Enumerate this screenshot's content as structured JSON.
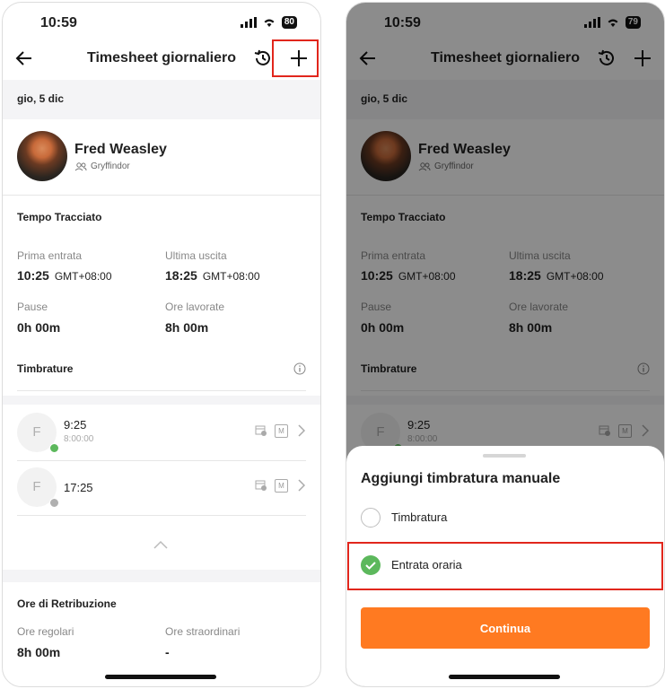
{
  "left": {
    "time": "10:59",
    "battery": "80",
    "title": "Timesheet giornaliero",
    "date": "gio, 5 dic",
    "user": {
      "name": "Fred Weasley",
      "team": "Gryffindor"
    },
    "tracked": {
      "title": "Tempo Tracciato",
      "first_in_label": "Prima entrata",
      "first_in_time": "10:25",
      "first_in_tz": "GMT+08:00",
      "last_out_label": "Ultima uscita",
      "last_out_time": "18:25",
      "last_out_tz": "GMT+08:00",
      "pause_label": "Pause",
      "pause_value": "0h 00m",
      "worked_label": "Ore lavorate",
      "worked_value": "8h 00m"
    },
    "punches": {
      "title": "Timbrature",
      "items": [
        {
          "initial": "F",
          "time": "9:25",
          "sub": "8:00:00",
          "badge": "M",
          "status_color": "#5cb85c"
        },
        {
          "initial": "F",
          "time": "17:25",
          "sub": "",
          "badge": "M",
          "status_color": "#b0b0b0"
        }
      ]
    },
    "pay": {
      "title": "Ore di Retribuzione",
      "regular_label": "Ore regolari",
      "regular_value": "8h 00m",
      "overtime_label": "Ore straordinari",
      "overtime_value": "-"
    }
  },
  "right": {
    "time": "10:59",
    "battery": "79",
    "title": "Timesheet giornaliero",
    "date": "gio, 5 dic",
    "user": {
      "name": "Fred Weasley",
      "team": "Gryffindor"
    },
    "tracked": {
      "title": "Tempo Tracciato",
      "first_in_label": "Prima entrata",
      "first_in_time": "10:25",
      "first_in_tz": "GMT+08:00",
      "last_out_label": "Ultima uscita",
      "last_out_time": "18:25",
      "last_out_tz": "GMT+08:00",
      "pause_label": "Pause",
      "pause_value": "0h 00m",
      "worked_label": "Ore lavorate",
      "worked_value": "8h 00m"
    },
    "punches": {
      "title": "Timbrature",
      "items": [
        {
          "initial": "F",
          "time": "9:25",
          "sub": "8:00:00",
          "badge": "M"
        }
      ]
    },
    "sheet": {
      "title": "Aggiungi timbratura manuale",
      "option_1": "Timbratura",
      "option_2": "Entrata oraria",
      "selected": "Entrata oraria",
      "button": "Continua"
    }
  },
  "colors": {
    "accent": "#ff7a21",
    "success": "#5cb85c",
    "highlight": "#e1261c"
  }
}
